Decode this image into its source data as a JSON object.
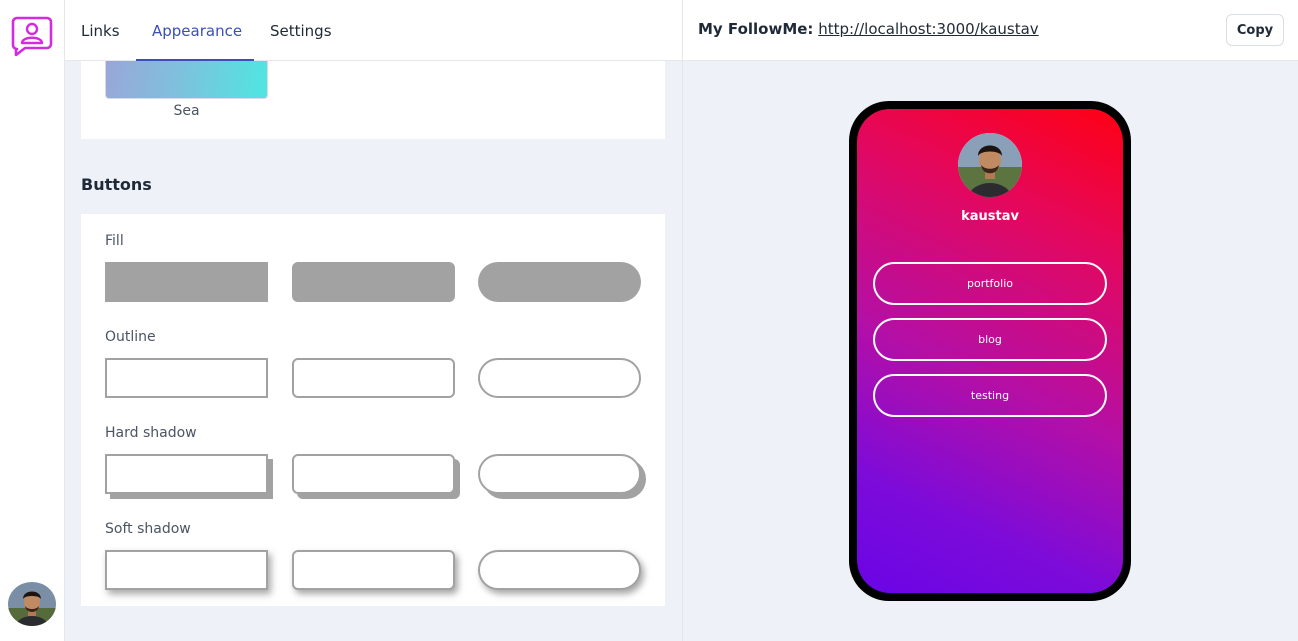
{
  "nav": {
    "tabs": [
      {
        "label": "Links"
      },
      {
        "label": "Appearance"
      },
      {
        "label": "Settings"
      }
    ],
    "active_tab": "Appearance"
  },
  "preview_bar": {
    "label": "My FollowMe:",
    "url": "http://localhost:3000/kaustav",
    "copy_label": "Copy"
  },
  "themes": {
    "visible": [
      {
        "name": "Sea"
      }
    ]
  },
  "buttons_section": {
    "title": "Buttons",
    "groups": [
      {
        "label": "Fill"
      },
      {
        "label": "Outline"
      },
      {
        "label": "Hard shadow"
      },
      {
        "label": "Soft shadow"
      }
    ]
  },
  "phone_preview": {
    "username": "kaustav",
    "links": [
      {
        "label": "portfolio"
      },
      {
        "label": "blog"
      },
      {
        "label": "testing"
      }
    ]
  },
  "colors": {
    "accent": "#3a4fb8",
    "logo": "#d42be0",
    "button_sample": "#a2a2a2",
    "gradient_top": "#ff0013",
    "gradient_bottom": "#6a05e6"
  }
}
